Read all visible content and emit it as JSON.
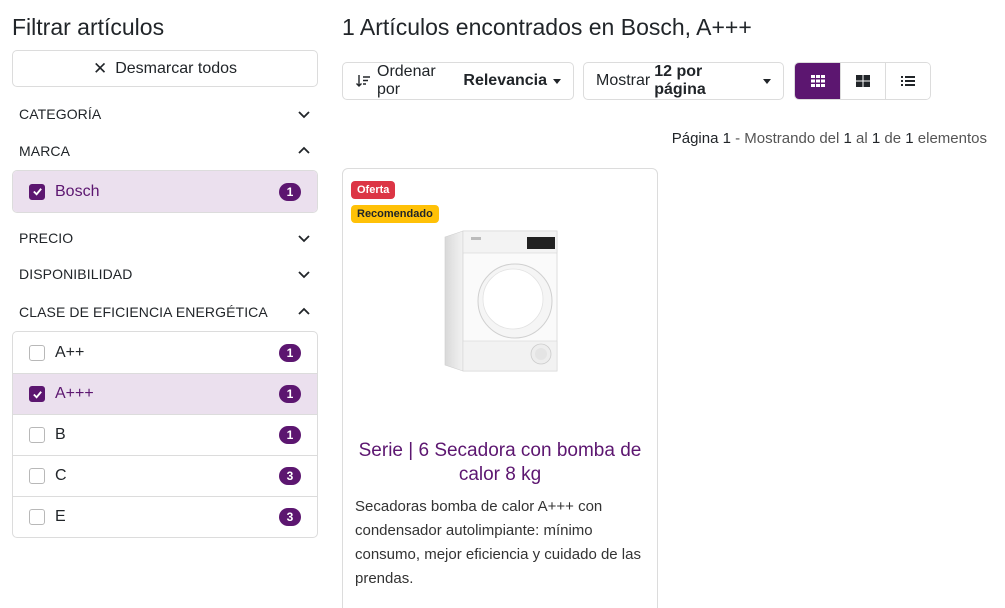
{
  "sidebar": {
    "title": "Filtrar artículos",
    "clear_button": "Desmarcar todos",
    "facets": {
      "categoria": {
        "label": "CATEGORÍA",
        "expanded": false
      },
      "marca": {
        "label": "MARCA",
        "expanded": true,
        "options": [
          {
            "label": "Bosch",
            "count": "1",
            "checked": true
          }
        ]
      },
      "precio": {
        "label": "PRECIO",
        "expanded": false
      },
      "disponibilidad": {
        "label": "DISPONIBILIDAD",
        "expanded": false
      },
      "eficiencia": {
        "label": "CLASE DE EFICIENCIA ENERGÉTICA",
        "expanded": true,
        "options": [
          {
            "label": "A++",
            "count": "1",
            "checked": false
          },
          {
            "label": "A+++",
            "count": "1",
            "checked": true
          },
          {
            "label": "B",
            "count": "1",
            "checked": false
          },
          {
            "label": "C",
            "count": "3",
            "checked": false
          },
          {
            "label": "E",
            "count": "3",
            "checked": false
          }
        ]
      }
    }
  },
  "main": {
    "title": "1 Artículos encontrados en Bosch, A+++",
    "sort": {
      "prefix": "Ordenar por",
      "value": "Relevancia"
    },
    "per_page": {
      "prefix": "Mostrar",
      "value": "12 por página"
    },
    "view_modes": [
      "grid-small",
      "grid-large",
      "list"
    ],
    "active_view": "grid-small",
    "paging": {
      "page_label": "Página",
      "page": "1",
      "showing": "- Mostrando del",
      "from": "1",
      "to_label": "al",
      "to": "1",
      "of_label": "de",
      "total": "1",
      "items_label": "elementos"
    },
    "product": {
      "badges": {
        "offer": "Oferta",
        "recommended": "Recomendado"
      },
      "title": "Serie | 6 Secadora con bomba de calor 8 kg",
      "description": "Secadoras bomba de calor A+++ con condensador autolimpiante: mínimo consumo, mejor eficiencia y cuidado de las prendas.",
      "image_icon": "dryer-appliance-image"
    }
  },
  "colors": {
    "accent": "#5c1670",
    "accent_light": "#ebe0ee",
    "offer": "#dc3545",
    "recommended": "#ffc107"
  }
}
